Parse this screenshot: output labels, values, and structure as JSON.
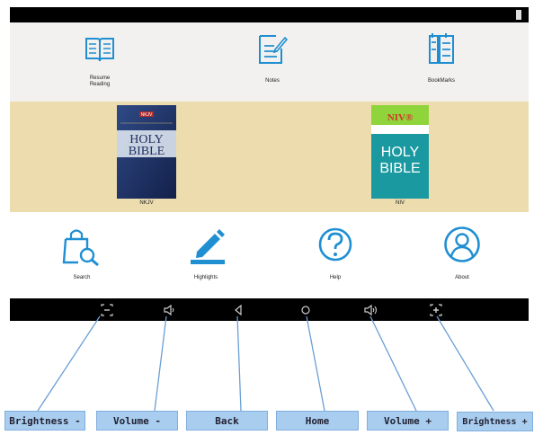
{
  "top_menu": {
    "items": [
      {
        "label_line1": "Resume",
        "label_line2": "Reading",
        "icon": "open-book-icon"
      },
      {
        "label": "Notes",
        "icon": "notes-pencil-icon"
      },
      {
        "label": "BookMarks",
        "icon": "bookmarks-icon"
      }
    ]
  },
  "books": [
    {
      "label": "NKJV",
      "cover_top": "NKJV",
      "cover_title_1": "HOLY",
      "cover_title_2": "BIBLE",
      "cover_color": "#1e2f5e"
    },
    {
      "label": "NIV",
      "cover_top": "NIV®",
      "cover_title_1": "HOLY",
      "cover_title_2": "BIBLE",
      "cover_color": "#1a9aa0"
    }
  ],
  "bottom_menu": {
    "items": [
      {
        "label": "Search",
        "icon": "search-bag-icon"
      },
      {
        "label": "Highlights",
        "icon": "highlighter-icon"
      },
      {
        "label": "Help",
        "icon": "help-icon"
      },
      {
        "label": "About",
        "icon": "user-icon"
      }
    ]
  },
  "nav_bar": {
    "buttons": [
      "brightness-down-icon",
      "volume-down-icon",
      "back-icon",
      "home-icon",
      "volume-up-icon",
      "brightness-up-icon"
    ]
  },
  "callouts": [
    "Brightness -",
    "Volume -",
    "Back",
    "Home",
    "Volume +",
    "Brightness +"
  ],
  "colors": {
    "accent": "#1f8fd2",
    "band": "#ecdcae",
    "callout": "#a9cdef"
  }
}
